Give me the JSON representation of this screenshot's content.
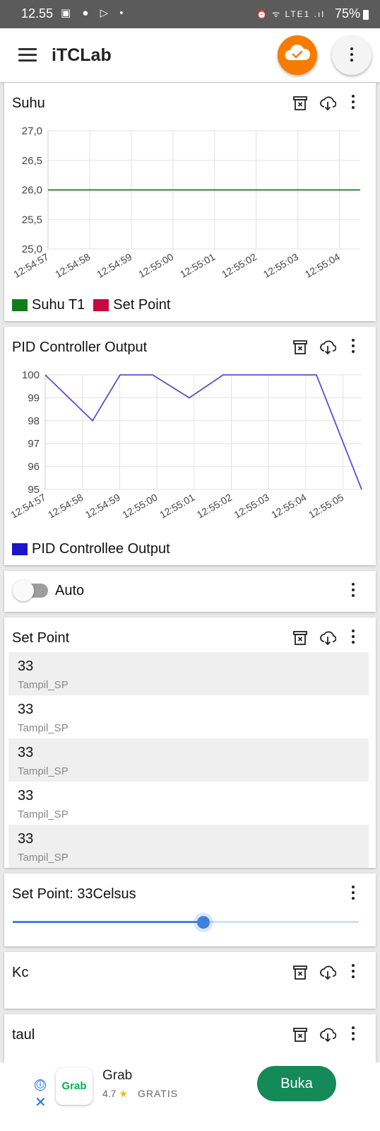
{
  "status_bar": {
    "time": "12.55",
    "left_icons": "▣ ● ▷ •",
    "right_icons": "⏰ ᯤ LTE1 .ıl",
    "battery": "75%"
  },
  "app_bar": {
    "title": "iTCLab",
    "icons": [
      "menu-icon",
      "cloud-check-icon",
      "more-vert-icon"
    ]
  },
  "cards": {
    "suhu": {
      "title": "Suhu",
      "legend": [
        {
          "label": "Suhu T1",
          "color": "#107d1a"
        },
        {
          "label": "Set Point",
          "color": "#c8093f"
        }
      ]
    },
    "pid": {
      "title": "PID Controller Output",
      "legend": [
        {
          "label": "PID Controllee Output",
          "color": "#1a16c9"
        }
      ]
    },
    "auto": {
      "label": "Auto",
      "toggle_state": "off"
    },
    "setpoint_list": {
      "title": "Set Point",
      "rows": [
        {
          "value": "33",
          "label": "Tampil_SP"
        },
        {
          "value": "33",
          "label": "Tampil_SP"
        },
        {
          "value": "33",
          "label": "Tampil_SP"
        },
        {
          "value": "33",
          "label": "Tampil_SP"
        },
        {
          "value": "33",
          "label": "Tampil_SP"
        }
      ]
    },
    "setpoint_slider": {
      "title": "Set Point: 33Celsus",
      "level_fraction": 0.55
    },
    "kc": {
      "title": "Kc"
    },
    "taul": {
      "title": "taul"
    }
  },
  "ad": {
    "logo_text": "Grab",
    "name": "Grab",
    "rating": "4.7",
    "star": "★",
    "free_label": "GRATIS",
    "button": "Buka",
    "info_icon": "ⓘ",
    "close_icon": "✕"
  },
  "chart_data": [
    {
      "type": "line",
      "title": "Suhu",
      "x": [
        "12:54:57",
        "12:54:58",
        "12:54:59",
        "12:55:00",
        "12:55:01",
        "12:55:02",
        "12:55:03",
        "12:55:04"
      ],
      "series": [
        {
          "name": "Suhu T1",
          "color": "#107d1a",
          "values": [
            26.0,
            26.0,
            26.0,
            26.0,
            26.0,
            26.0,
            26.0,
            26.0
          ]
        },
        {
          "name": "Set Point",
          "color": "#c8093f",
          "values": []
        }
      ],
      "y_ticks": [
        "27,0",
        "26,5",
        "26,0",
        "25,5",
        "25,0"
      ],
      "ylim": [
        25.0,
        27.0
      ],
      "grid": true,
      "legend": "bottom-left"
    },
    {
      "type": "line",
      "title": "PID Controller Output",
      "x": [
        "12:54:57",
        "12:54:58",
        "12:54:59",
        "12:55:00",
        "12:55:01",
        "12:55:02",
        "12:55:03",
        "12:55:04",
        "12:55:05"
      ],
      "series": [
        {
          "name": "PID Controllee Output",
          "color": "#5a4fd0",
          "values": [
            100,
            98,
            100,
            100,
            99,
            100,
            100,
            100,
            95
          ]
        }
      ],
      "y_ticks": [
        "100",
        "99",
        "98",
        "97",
        "96",
        "95"
      ],
      "ylim": [
        95,
        100
      ],
      "grid": true,
      "legend": "bottom-left"
    }
  ]
}
